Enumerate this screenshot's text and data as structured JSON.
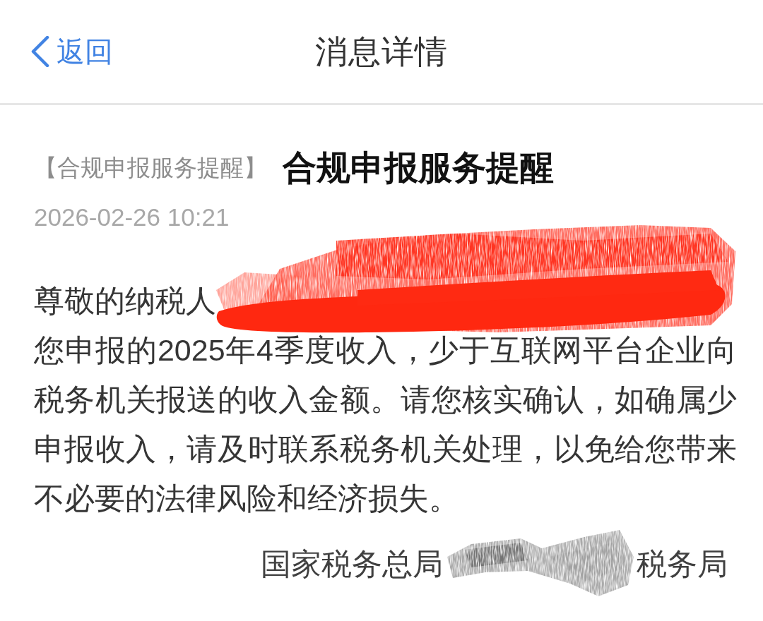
{
  "header": {
    "back_label": "返回",
    "title": "消息详情"
  },
  "message": {
    "tag": "【合规申报服务提醒】",
    "title": "合规申报服务提醒",
    "time": "2026-02-26 10:21",
    "greeting": "尊敬的纳税人",
    "body": "您申报的2025年4季度收入，少于互联网平台企业向税务机关报送的收入金额。请您核实确认，如确属少申报收入，请及时联系税务机关处理，以免给您带来不必要的法律风险和经济损失。",
    "signature": [
      "国家税务总局",
      "税务局"
    ]
  }
}
